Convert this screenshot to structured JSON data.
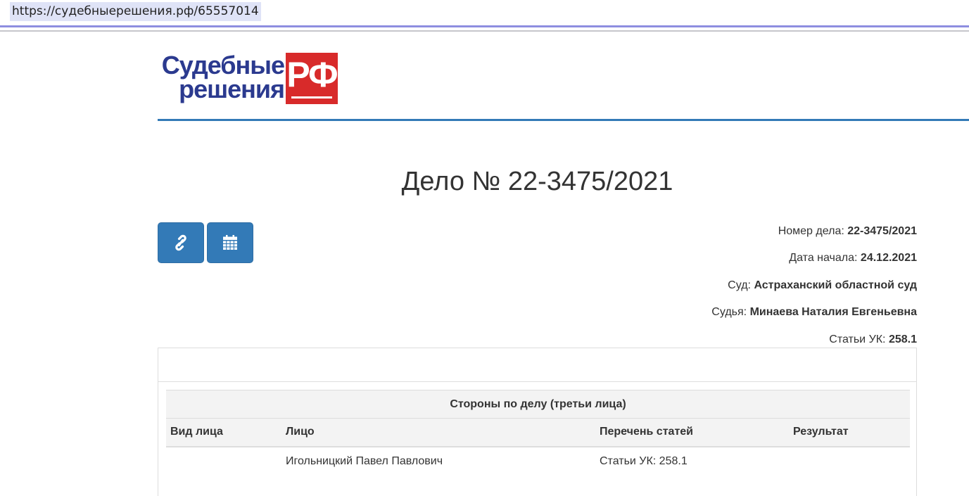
{
  "browser": {
    "url": "https://судебныерешения.рф/65557014"
  },
  "logo": {
    "line1": "Судебные",
    "line2": "решения",
    "badge": "РФ"
  },
  "page": {
    "title": "Дело № 22-3475/2021"
  },
  "buttons": [
    {
      "icon": "link-icon"
    },
    {
      "icon": "calendar-icon"
    }
  ],
  "info": {
    "case_number": {
      "label": "Номер дела:",
      "value": "22-3475/2021"
    },
    "start_date": {
      "label": "Дата начала:",
      "value": "24.12.2021"
    },
    "court": {
      "label": "Суд:",
      "value": "Астраханский областной суд"
    },
    "judge": {
      "label": "Судья:",
      "value": "Минаева Наталия Евгеньевна"
    },
    "articles": {
      "label": "Статьи УК:",
      "value": "258.1"
    }
  },
  "parties": {
    "caption": "Стороны по делу (третьи лица)",
    "columns": [
      "Вид лица",
      "Лицо",
      "Перечень статей",
      "Результат"
    ],
    "rows": [
      [
        "",
        "Игольницкий Павел Павлович",
        "Статьи УК: 258.1",
        ""
      ]
    ]
  },
  "colors": {
    "accent": "#337ab7",
    "logo_red": "#d82a2a",
    "logo_blue": "#2b3a8f"
  }
}
